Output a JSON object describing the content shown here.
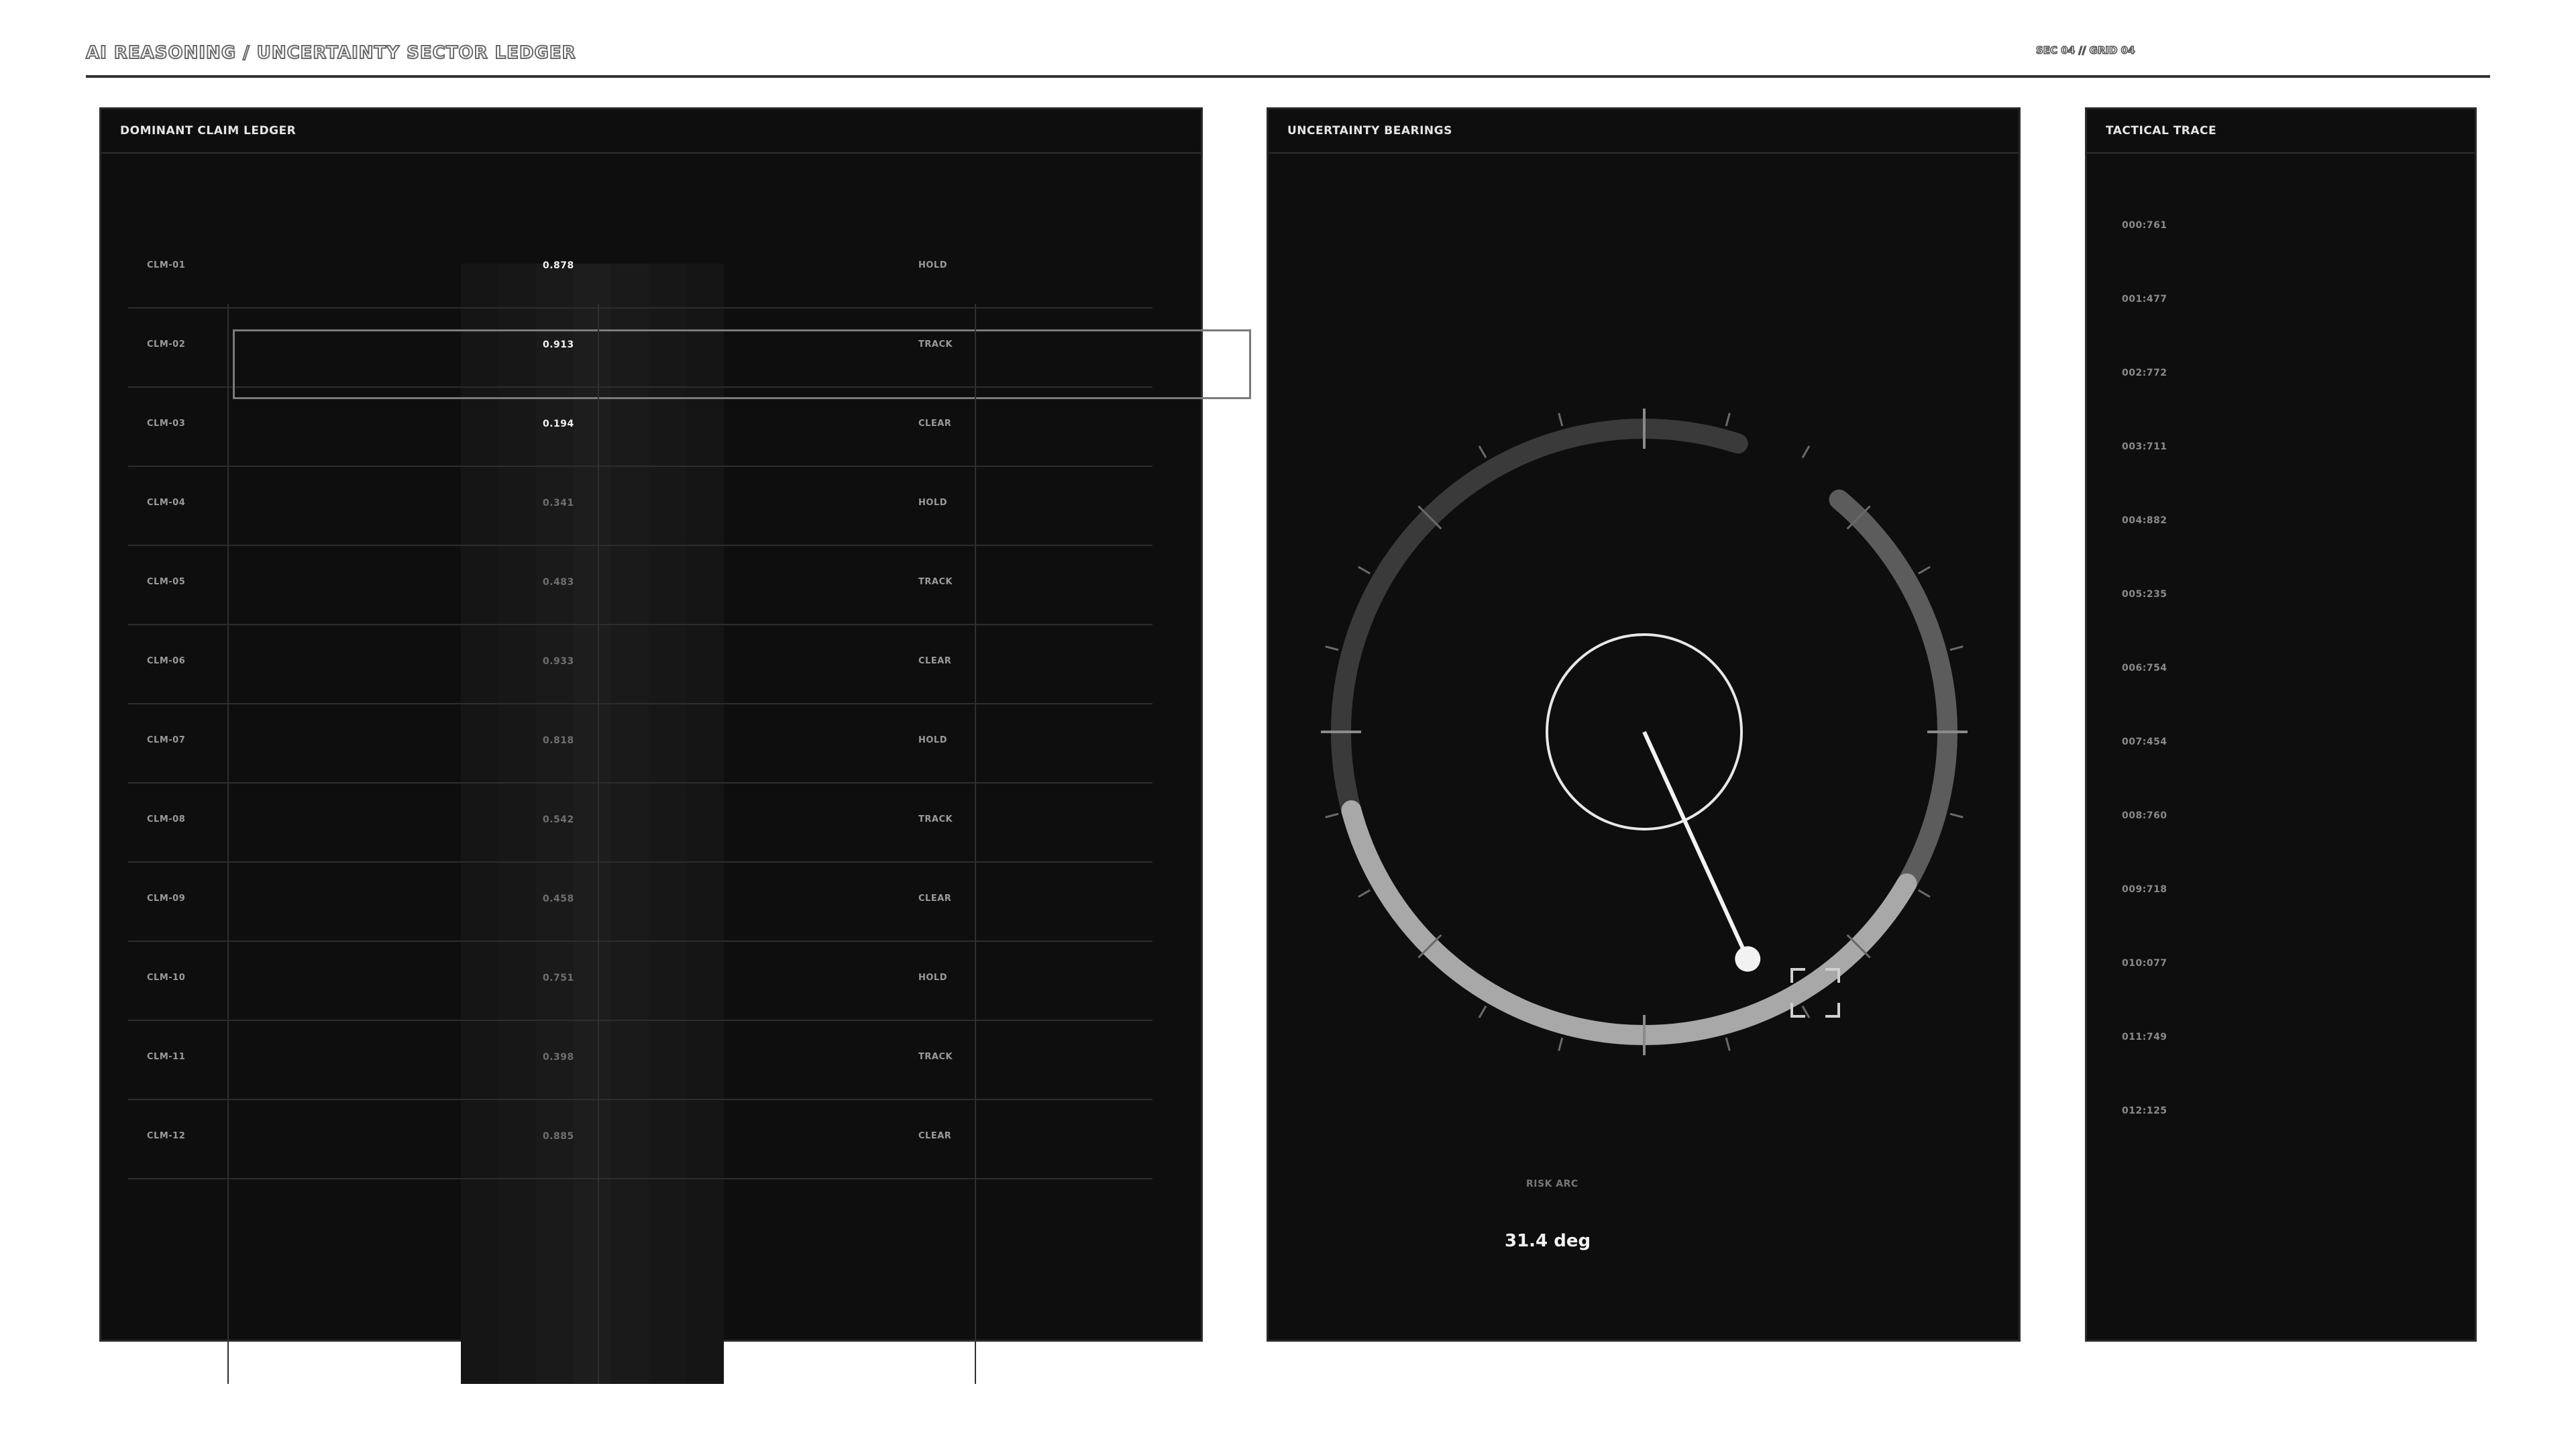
{
  "page": {
    "title": "AI REASONING / UNCERTAINTY SECTOR LEDGER",
    "meta": "SEC 04 // GRID 04"
  },
  "ledger": {
    "title": "DOMINANT CLAIM LEDGER",
    "selected_row": 1,
    "rows": [
      {
        "id": "CLM-01",
        "score": "0.878",
        "status": "HOLD",
        "highlight": true
      },
      {
        "id": "CLM-02",
        "score": "0.913",
        "status": "TRACK",
        "highlight": true
      },
      {
        "id": "CLM-03",
        "score": "0.194",
        "status": "CLEAR",
        "highlight": true
      },
      {
        "id": "CLM-04",
        "score": "0.341",
        "status": "HOLD",
        "highlight": false
      },
      {
        "id": "CLM-05",
        "score": "0.483",
        "status": "TRACK",
        "highlight": false
      },
      {
        "id": "CLM-06",
        "score": "0.933",
        "status": "CLEAR",
        "highlight": false
      },
      {
        "id": "CLM-07",
        "score": "0.818",
        "status": "HOLD",
        "highlight": false
      },
      {
        "id": "CLM-08",
        "score": "0.542",
        "status": "TRACK",
        "highlight": false
      },
      {
        "id": "CLM-09",
        "score": "0.458",
        "status": "CLEAR",
        "highlight": false
      },
      {
        "id": "CLM-10",
        "score": "0.751",
        "status": "HOLD",
        "highlight": false
      },
      {
        "id": "CLM-11",
        "score": "0.398",
        "status": "TRACK",
        "highlight": false
      },
      {
        "id": "CLM-12",
        "score": "0.885",
        "status": "CLEAR",
        "highlight": false
      }
    ]
  },
  "bearings": {
    "title": "UNCERTAINTY BEARINGS",
    "risk_label": "RISK ARC",
    "risk_value": "31.4 deg",
    "colors": {
      "ring_dark": "#3a3a3a",
      "ring_mid": "#5c5c5c",
      "ring_light": "#a8a8a8",
      "needle": "#f2f2f2"
    }
  },
  "trace": {
    "title": "TACTICAL TRACE",
    "items": [
      "000:761",
      "001:477",
      "002:772",
      "003:711",
      "004:882",
      "005:235",
      "006:754",
      "007:454",
      "008:760",
      "009:718",
      "010:077",
      "011:749",
      "012:125"
    ]
  }
}
